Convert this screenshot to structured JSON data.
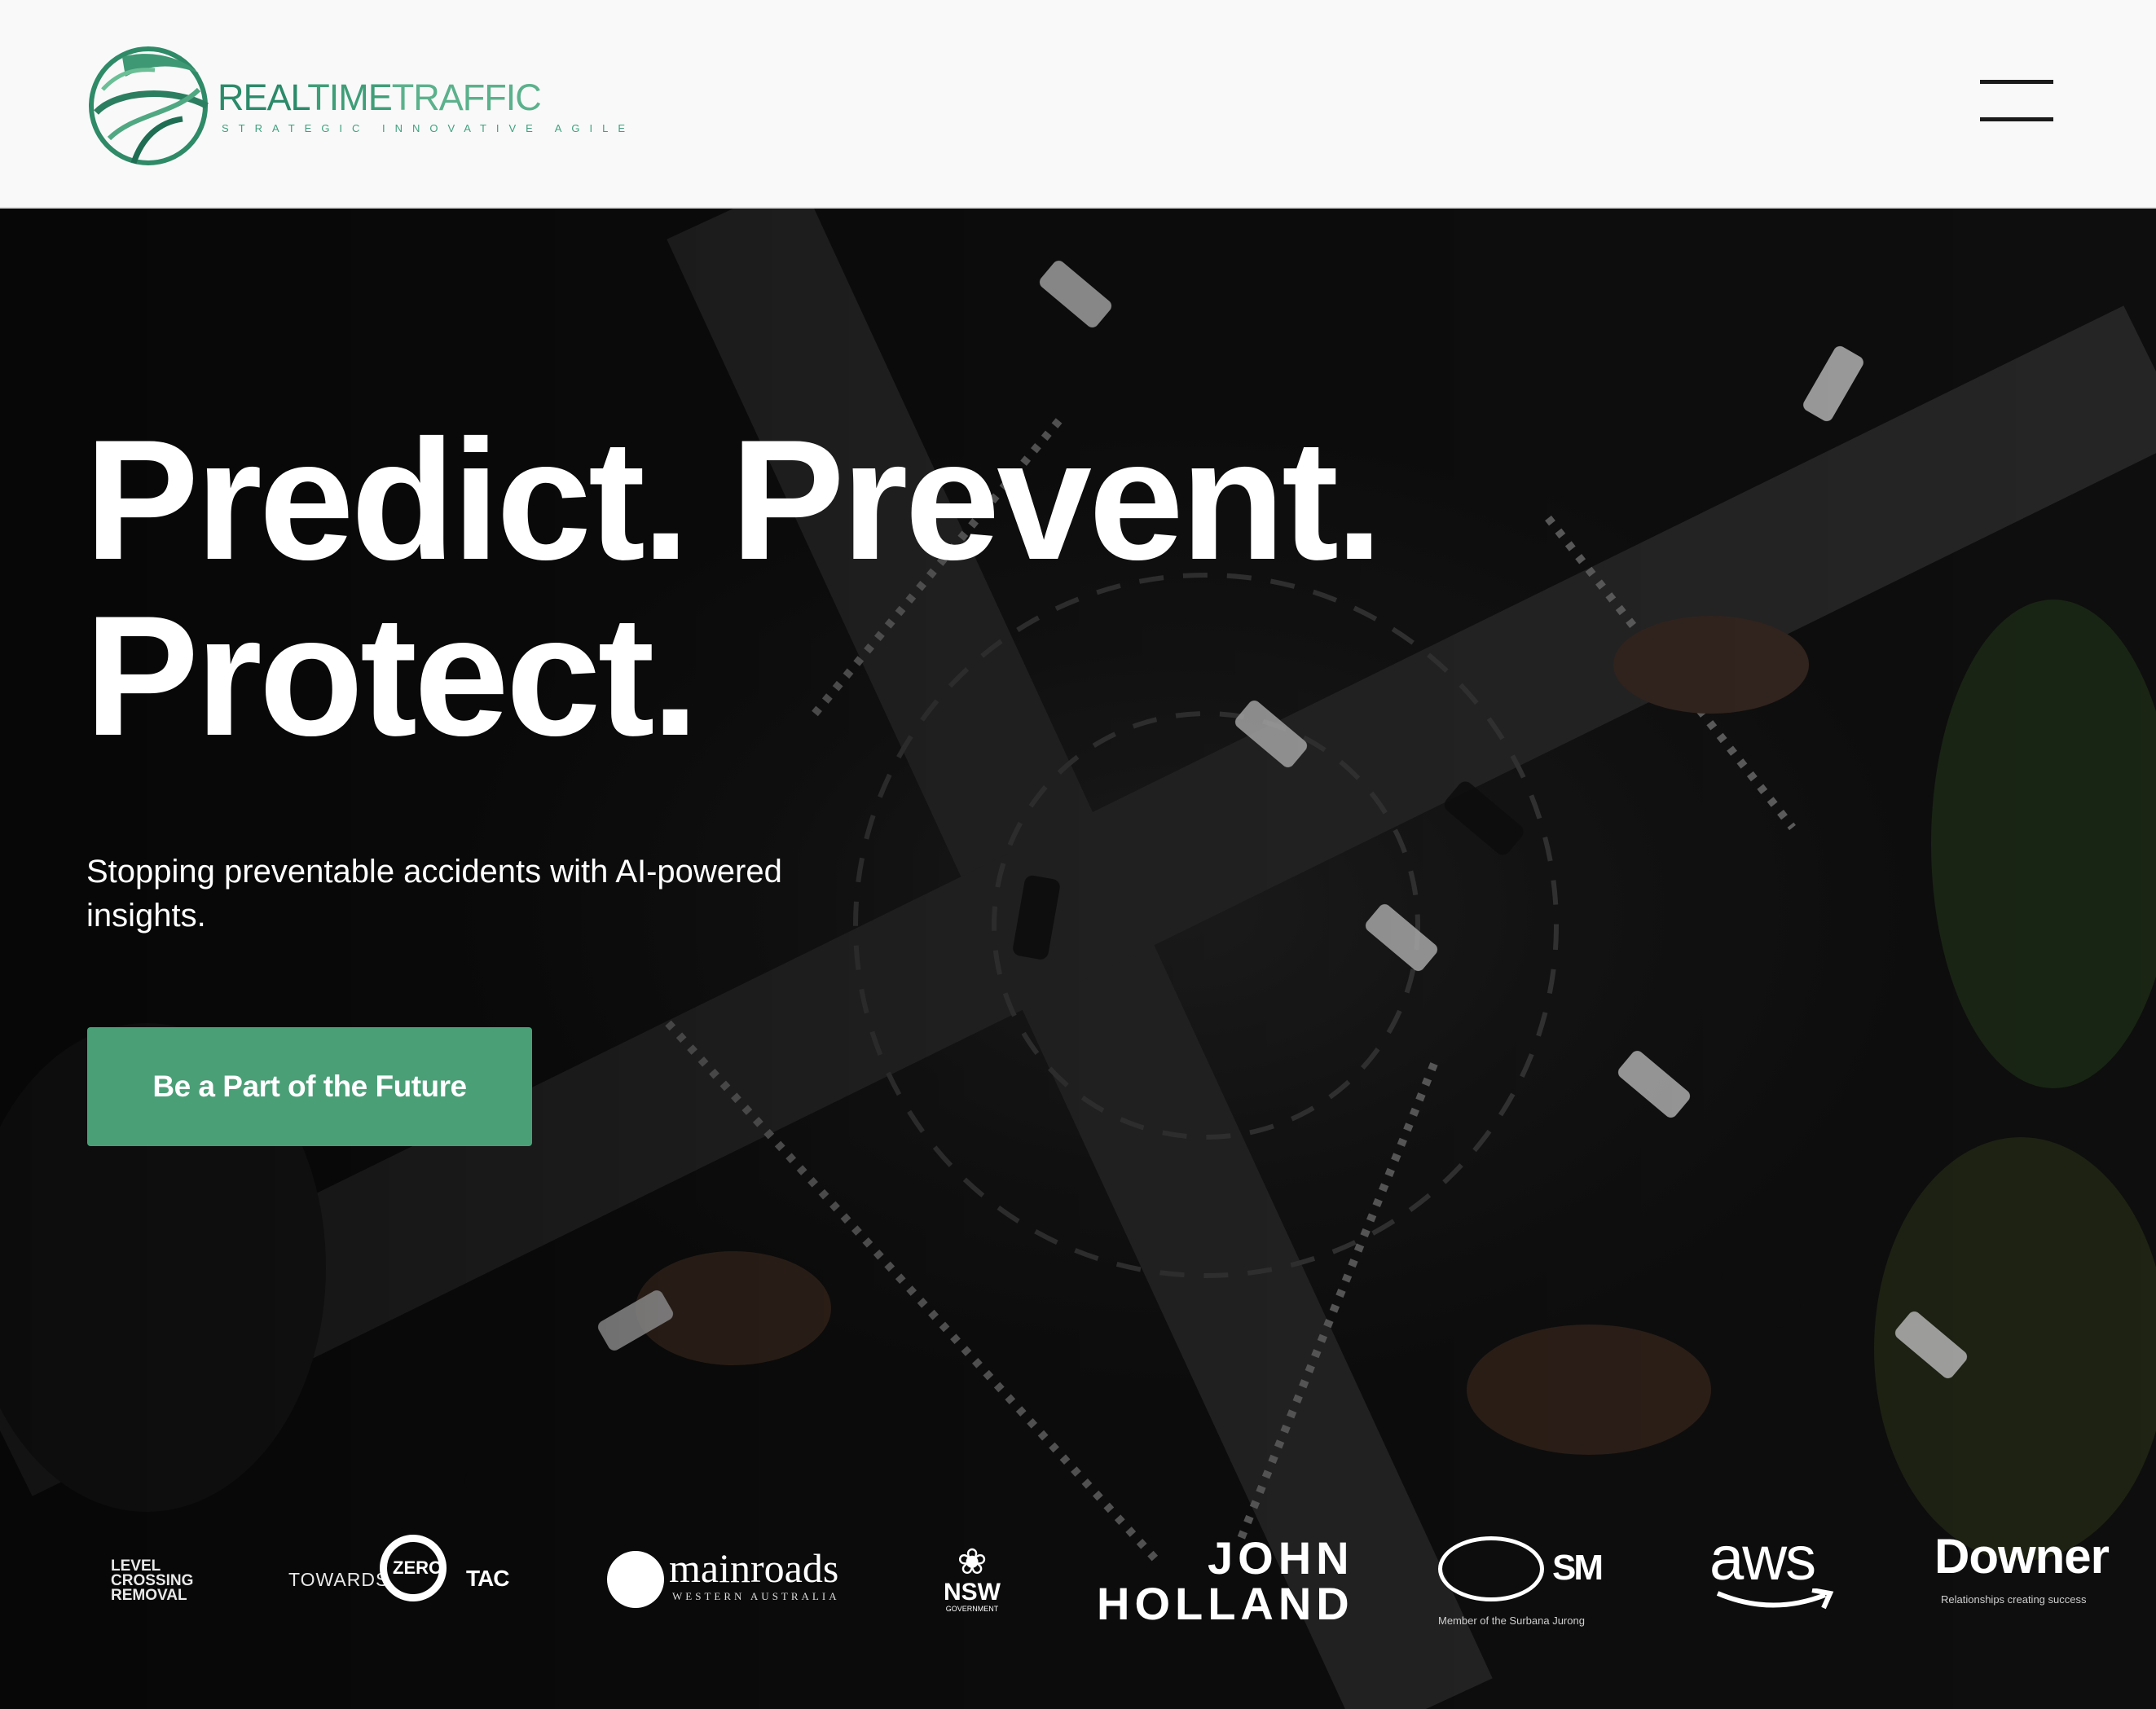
{
  "header": {
    "logo": {
      "icon": "globe-swoosh-logo-icon",
      "wordmark_parts": [
        "REAL",
        "TIME",
        "TRAFFIC"
      ],
      "tagline": "STRATEGIC INNOVATIVE AGILE"
    },
    "menu": {
      "icon": "hamburger-menu-icon"
    }
  },
  "hero": {
    "background": "aerial night view of a busy road intersection",
    "headline_line1": "Predict. Prevent.",
    "headline_line2": "Protect.",
    "subtext": "Stopping preventable accidents with AI-powered insights.",
    "cta_label": "Be a Part of the Future"
  },
  "partners": {
    "level_crossing": "LEVEL CROSSING REMOVAL",
    "towards_zero_prefix": "TOWARDS",
    "towards_zero_zero": "ZERO",
    "tac": "TAC",
    "mainroads": "mainroads",
    "mainroads_sub": "WESTERN AUSTRALIA",
    "nsw": "NSW",
    "nsw_sub": "GOVERNMENT",
    "john_holland_line1": "JOHN",
    "john_holland_line2": "HOLLAND",
    "ism": "SM",
    "ism_sub": "Member of the Surbana Jurong",
    "aws": "aws",
    "downer": "Downer",
    "downer_sub": "Relationships creating success"
  },
  "colors": {
    "brand_green": "#4a9f77",
    "logo_green": "#2b8a6a",
    "header_bg": "#f9f9f9",
    "hero_text": "#ffffff"
  }
}
